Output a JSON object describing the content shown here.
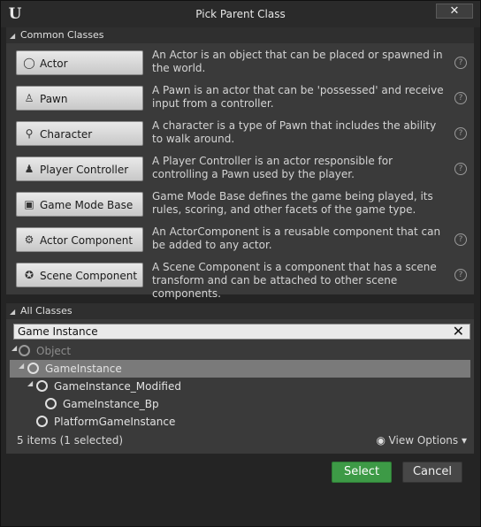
{
  "window": {
    "title": "Pick Parent Class",
    "close_label": "✕"
  },
  "common": {
    "header": "Common Classes",
    "classes": [
      {
        "label": "Actor",
        "desc": "An Actor is an object that can be placed or spawned in the world.",
        "icon": "actor-icon"
      },
      {
        "label": "Pawn",
        "desc": "A Pawn is an actor that can be 'possessed' and receive input from a controller.",
        "icon": "pawn-icon"
      },
      {
        "label": "Character",
        "desc": "A character is a type of Pawn that includes the ability to walk around.",
        "icon": "character-icon"
      },
      {
        "label": "Player Controller",
        "desc": "A Player Controller is an actor responsible for controlling a Pawn used by the player.",
        "icon": "player-controller-icon"
      },
      {
        "label": "Game Mode Base",
        "desc": "Game Mode Base defines the game being played, its rules, scoring, and other facets of the game type.",
        "icon": "game-mode-icon"
      },
      {
        "label": "Actor Component",
        "desc": "An ActorComponent is a reusable component that can be added to any actor.",
        "icon": "actor-component-icon"
      },
      {
        "label": "Scene Component",
        "desc": "A Scene Component is a component that has a scene transform and can be attached to other scene components.",
        "icon": "scene-component-icon"
      }
    ]
  },
  "all": {
    "header": "All Classes",
    "search_value": "Game Instance",
    "tree": [
      {
        "label": "Object"
      },
      {
        "label": "GameInstance"
      },
      {
        "label": "GameInstance_Modified"
      },
      {
        "label": "GameInstance_Bp"
      },
      {
        "label": "PlatformGameInstance"
      }
    ],
    "count": "5 items (1 selected)",
    "view_options": "View Options"
  },
  "buttons": {
    "select": "Select",
    "cancel": "Cancel"
  },
  "colors": {
    "accent": "#3d9a46",
    "selection": "#7a7a7a"
  }
}
